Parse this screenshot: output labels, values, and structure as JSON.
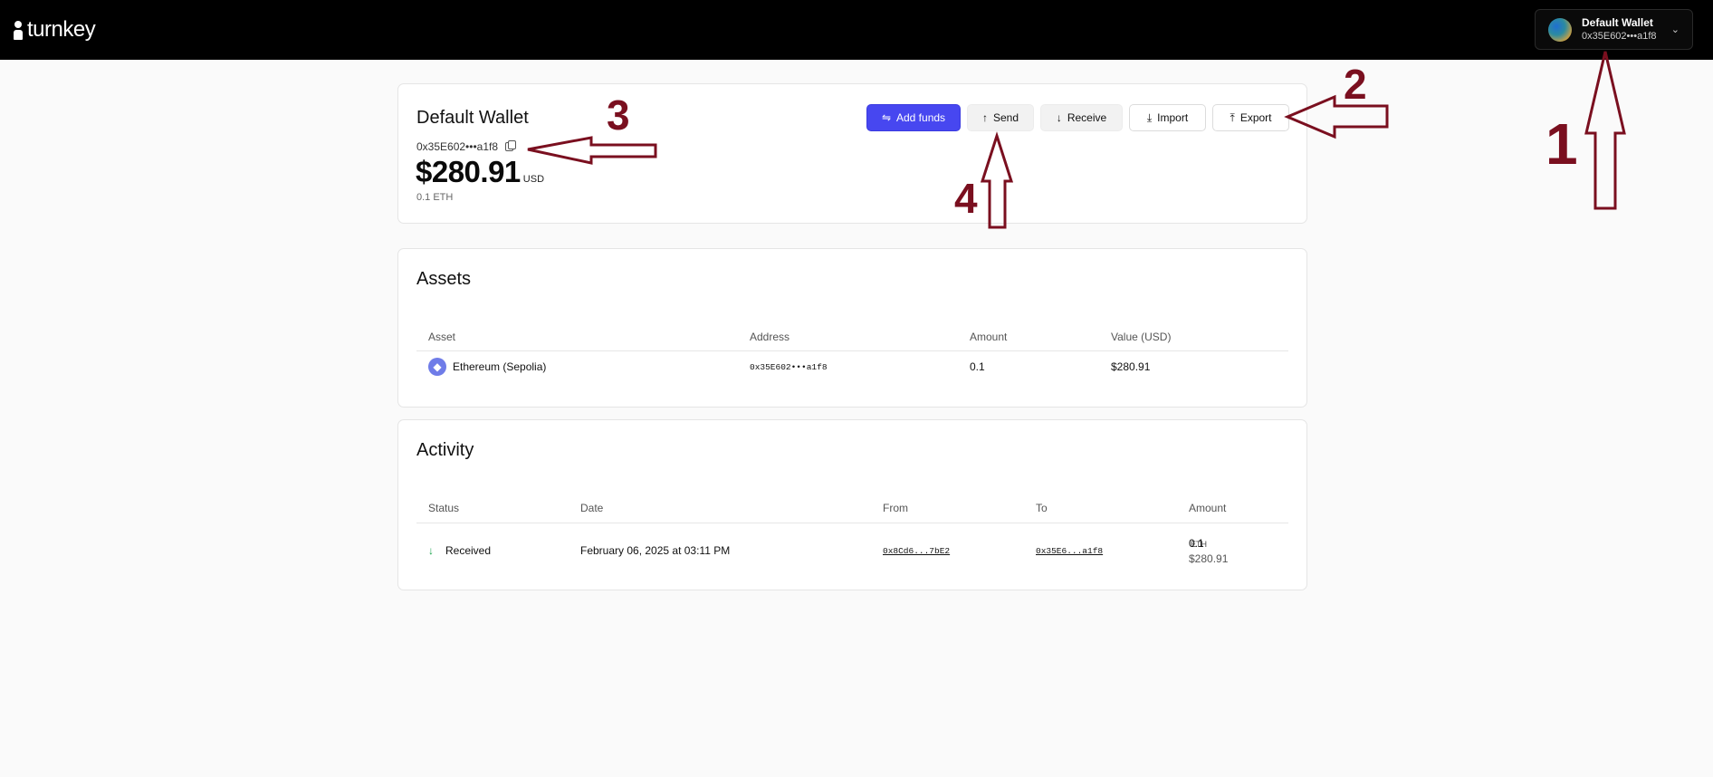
{
  "header": {
    "logo_text": "turnkey",
    "wallet_selector": {
      "name": "Default Wallet",
      "address": "0x35E602•••a1f8"
    }
  },
  "wallet": {
    "title": "Default Wallet",
    "address": "0x35E602•••a1f8",
    "balance": "$280.91",
    "currency": "USD",
    "eth_amount": "0.1 ETH",
    "buttons": {
      "add_funds": "Add funds",
      "send": "Send",
      "receive": "Receive",
      "import": "Import",
      "export": "Export"
    }
  },
  "assets": {
    "title": "Assets",
    "columns": [
      "Asset",
      "Address",
      "Amount",
      "Value (USD)"
    ],
    "rows": [
      {
        "asset": "Ethereum (Sepolia)",
        "address": "0x35E602•••a1f8",
        "amount": "0.1",
        "value": "$280.91"
      }
    ]
  },
  "activity": {
    "title": "Activity",
    "columns": [
      "Status",
      "Date",
      "From",
      "To",
      "Amount"
    ],
    "rows": [
      {
        "status": "Received",
        "date": "February 06, 2025 at 03:11 PM",
        "from": "0x8Cd6...7bE2",
        "to": "0x35E6...a1f8",
        "amount": "0.1",
        "amount_unit": "ETH",
        "amount_usd": "$280.91"
      }
    ]
  },
  "annotations": {
    "n1": "1",
    "n2": "2",
    "n3": "3",
    "n4": "4",
    "color": "#7a0f1f"
  }
}
